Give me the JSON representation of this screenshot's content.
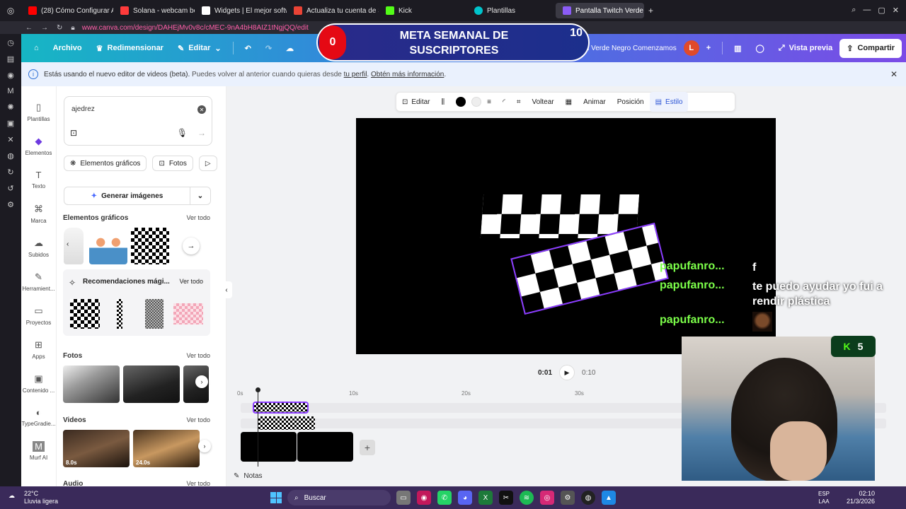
{
  "browser": {
    "tabs": [
      {
        "label": "(28) Cómo Configurar ALE",
        "color": "#ff0000"
      },
      {
        "label": "Solana - webcam bottom",
        "color": "#ff3b3b"
      },
      {
        "label": "Widgets | El mejor softwa",
        "color": "#ffffff"
      },
      {
        "label": "Actualiza tu cuenta de St",
        "color": "#ea4335"
      },
      {
        "label": "Kick",
        "color": "#53fc18"
      },
      {
        "label": "Plantillas",
        "color": "#00c4cc"
      },
      {
        "label": "Pantalla Twitch Verde Neg",
        "color": "#8b5cf6"
      }
    ],
    "url": "www.canva.com/design/DAHEjMv0v8c/cMEC-9nA4bH8AIZ1tNgjQQ/edit"
  },
  "header": {
    "home_icon": "home-icon",
    "archivo": "Archivo",
    "redimensionar": "Redimensionar",
    "editar": "Editar",
    "project_title": "Pantalla Twitch Verde Negro Comenzamos",
    "avatar_letter": "L",
    "vista_previa": "Vista previa",
    "compartir": "Compartir"
  },
  "overlay": {
    "current": "0",
    "title": "META SEMANAL DE SUSCRIPTORES",
    "target": "10"
  },
  "banner": {
    "text": "Estás usando el nuevo editor de videos (beta).",
    "text2": "Puedes volver al anterior cuando quieras desde",
    "link1": "tu perfil",
    "link2": "Obtén más información"
  },
  "nav": [
    {
      "label": "Plantillas",
      "icon": "template-icon"
    },
    {
      "label": "Elementos",
      "icon": "elements-icon"
    },
    {
      "label": "Texto",
      "icon": "text-icon"
    },
    {
      "label": "Marca",
      "icon": "brand-icon"
    },
    {
      "label": "Subidos",
      "icon": "upload-icon"
    },
    {
      "label": "Herramient...",
      "icon": "tools-icon"
    },
    {
      "label": "Proyectos",
      "icon": "folder-icon"
    },
    {
      "label": "Apps",
      "icon": "apps-icon"
    },
    {
      "label": "Contenido ...",
      "icon": "content-icon"
    },
    {
      "label": "TypeGradie...",
      "icon": "typegradient-icon"
    },
    {
      "label": "Murf AI",
      "icon": "murf-icon"
    }
  ],
  "panel": {
    "search_value": "ajedrez",
    "chip_graphics": "Elementos gráficos",
    "chip_photos": "Fotos",
    "generate": "Generar imágenes",
    "graphics_title": "Elementos gráficos",
    "see_all": "Ver todo",
    "recs_title": "Recomendaciones mági...",
    "photos_title": "Fotos",
    "videos_title": "Videos",
    "video1_dur": "8.0s",
    "video2_dur": "24.0s",
    "audio_title": "Audio"
  },
  "toolbar": {
    "editar": "Editar",
    "voltear": "Voltear",
    "animar": "Animar",
    "posicion": "Posición",
    "estilo": "Estilo"
  },
  "chat": [
    {
      "user": "papufanro...",
      "msg": "f"
    },
    {
      "user": "papufanro...",
      "msg": "te puedo ayudar yo fui a rendir plástica"
    },
    {
      "user": "papufanro...",
      "msg": ""
    }
  ],
  "player": {
    "current_time": "0:01",
    "total_time": "0:10"
  },
  "timeline": {
    "ticks": [
      "0s",
      "10s",
      "20s",
      "30s"
    ],
    "notes": "Notas"
  },
  "kick": {
    "count": "5"
  },
  "taskbar": {
    "temp": "22°C",
    "weather": "Lluvia ligera",
    "search": "Buscar",
    "lang1": "ESP",
    "lang2": "LAA",
    "time": "02:10",
    "date": "21/3/2026"
  },
  "colors": {
    "accent": "#8b3dff",
    "header_start": "#16b6c4",
    "header_end": "#7b4be6",
    "chat_name": "#7cff4a"
  }
}
